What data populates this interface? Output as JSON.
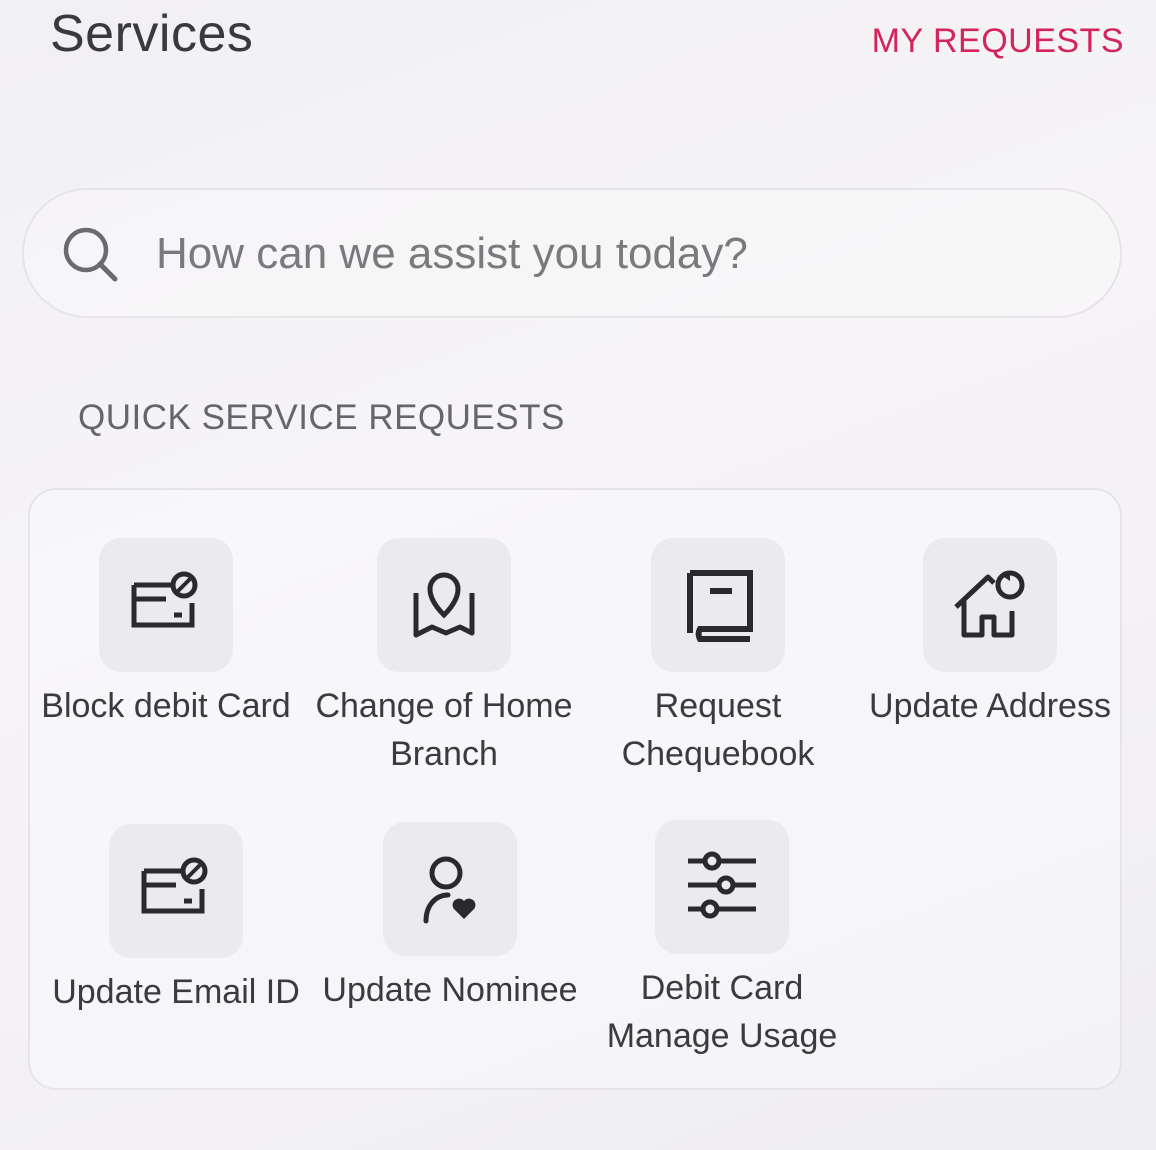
{
  "header": {
    "title": "Services",
    "my_requests_label": "MY REQUESTS"
  },
  "search": {
    "placeholder": "How can we assist you today?",
    "icon": "search-icon"
  },
  "quick_services": {
    "heading": "QUICK SERVICE REQUESTS",
    "items": [
      {
        "label": "Block debit Card",
        "icon": "card-block-icon"
      },
      {
        "label": "Change of Home Branch",
        "icon": "map-pin-icon"
      },
      {
        "label": "Request Chequebook",
        "icon": "book-icon"
      },
      {
        "label": "Update Address",
        "icon": "home-refresh-icon"
      },
      {
        "label": "Update Email ID",
        "icon": "card-block-icon"
      },
      {
        "label": "Update Nominee",
        "icon": "person-heart-icon"
      },
      {
        "label": "Debit Card Manage Usage",
        "icon": "sliders-icon"
      }
    ]
  },
  "colors": {
    "accent": "#d4245f",
    "icon_bg": "#ebeaee",
    "text": "#3b3b3f"
  }
}
